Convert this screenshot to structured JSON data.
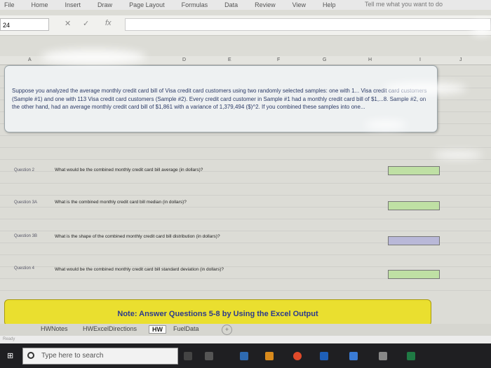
{
  "ribbon": {
    "tabs": [
      "File",
      "Home",
      "Insert",
      "Draw",
      "Page Layout",
      "Formulas",
      "Data",
      "Review",
      "View",
      "Help"
    ],
    "tell_me": "Tell me what you want to do"
  },
  "formula_bar": {
    "name_box": "24",
    "fx": "fx",
    "value": ""
  },
  "columns": [
    "A",
    "D",
    "E",
    "F",
    "G",
    "H",
    "I",
    "J"
  ],
  "prompt": {
    "text": "Suppose you analyzed the average monthly credit card bill of Visa credit card customers using two randomly selected samples: one with 1... Visa credit card customers (Sample #1) and one with 113 Visa credit card customers (Sample #2). Every credit card customer in Sample #1 had a monthly credit card bill of $1,...8. Sample #2, on the other hand, had an average monthly credit card bill of $1,861 with a variance of 1,379,494 ($)^2. If you combined these samples into one..."
  },
  "questions": [
    {
      "label": "Question 2",
      "text": "What would be the combined monthly credit card bill average (in dollars)?",
      "answer_color": "#bfe0a4"
    },
    {
      "label": "Question 3A",
      "text": "What is the combined monthly credit card bill median (in dollars)?",
      "answer_color": "#bfe0a4"
    },
    {
      "label": "Question 3B",
      "text": "What is the shape of the combined monthly credit card bill distribution (in dollars)?",
      "answer_color": "#b9b8d8"
    },
    {
      "label": "Question 4",
      "text": "What would be the combined monthly credit card bill standard deviation (in dollars)?",
      "answer_color": "#bfe0a4"
    }
  ],
  "note": {
    "text": "Note: Answer Questions 5-8 by Using the Excel Output"
  },
  "sheet_tabs": [
    "HWNotes",
    "HWExcelDirections",
    "HW",
    "FuelData"
  ],
  "active_sheet": "HW",
  "status": {
    "text": "Ready"
  },
  "taskbar": {
    "search_placeholder": "Type here to search"
  },
  "colors": {
    "note_bg": "#eadf2f",
    "note_text": "#2c3a8c",
    "prompt_text": "#2b3a66"
  }
}
